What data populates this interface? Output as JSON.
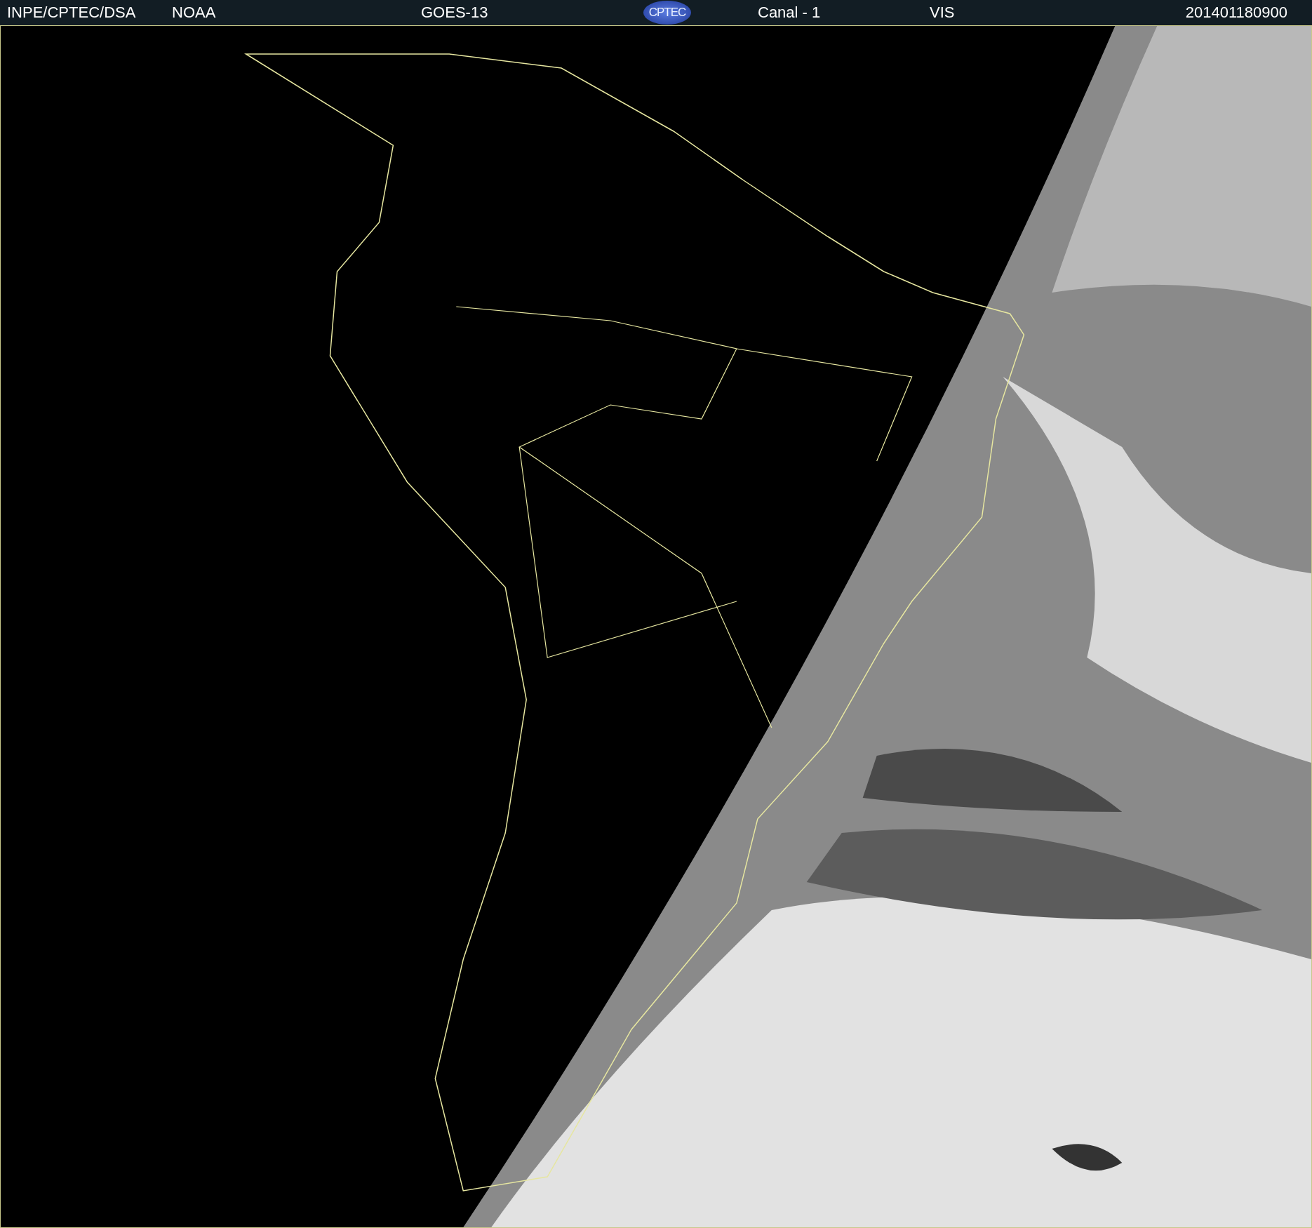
{
  "header": {
    "source": "INPE/CPTEC/DSA",
    "agency": "NOAA",
    "satellite": "GOES-13",
    "logo": "CPTEC",
    "channel": "Canal - 1",
    "band": "VIS",
    "timestamp": "201401180900"
  }
}
